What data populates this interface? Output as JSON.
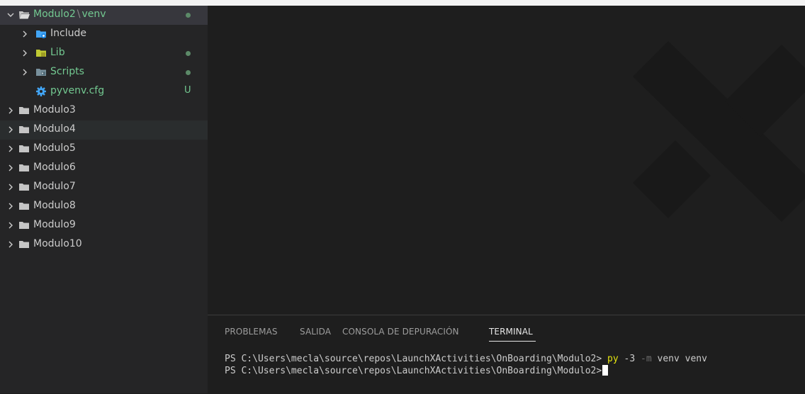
{
  "explorer": {
    "root": {
      "label": "Modulo2",
      "sep": "\\",
      "sub": "venv"
    },
    "items": [
      {
        "label": "Include",
        "icon": "folder-include-icon",
        "status": ""
      },
      {
        "label": "Lib",
        "icon": "folder-lib-icon",
        "status": "dot"
      },
      {
        "label": "Scripts",
        "icon": "folder-scripts-icon",
        "status": "dot"
      },
      {
        "label": "pyvenv.cfg",
        "icon": "gear-icon",
        "status": "U"
      }
    ],
    "folders": [
      "Modulo3",
      "Modulo4",
      "Modulo5",
      "Modulo6",
      "Modulo7",
      "Modulo8",
      "Modulo9",
      "Modulo10"
    ]
  },
  "panel": {
    "tabs": [
      "PROBLEMAS",
      "SALIDA",
      "CONSOLA DE DEPURACIÓN",
      "TERMINAL"
    ],
    "active_tab": "TERMINAL"
  },
  "terminal": {
    "prompt": "PS C:\\Users\\mecla\\source\\repos\\LaunchXActivities\\OnBoarding\\Modulo2>",
    "cmd_exe": "py",
    "cmd_version": "-3",
    "cmd_flag": "-m",
    "cmd_args": "venv venv"
  },
  "colors": {
    "sidebar": "#252526",
    "editor": "#1e1e1e",
    "git_untracked": "#73c991",
    "terminal_yellow": "#e5e510"
  }
}
